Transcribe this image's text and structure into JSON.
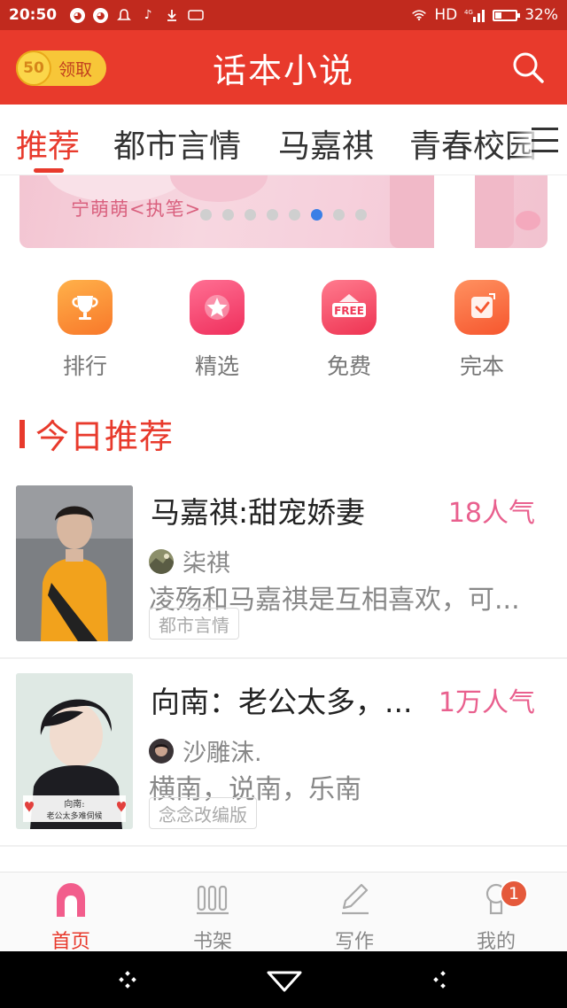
{
  "status_bar": {
    "time": "20:50",
    "network": "HD",
    "signal_label": "4G",
    "battery": "32%",
    "battery_level": 0.32
  },
  "header": {
    "coin_value": "50",
    "coin_label": "领取",
    "title": "话本小说"
  },
  "tabs": [
    {
      "label": "推荐",
      "active": true
    },
    {
      "label": "都市言情"
    },
    {
      "label": "马嘉祺"
    },
    {
      "label": "青春校园"
    }
  ],
  "banner": {
    "author_text": "宁萌萌<执笔>",
    "page_count": 8,
    "active_page": 6
  },
  "entries": [
    {
      "label": "排行",
      "icon": "trophy-icon",
      "color": "#fb8a2e"
    },
    {
      "label": "精选",
      "icon": "star-icon",
      "color": "#f6456e"
    },
    {
      "label": "免费",
      "icon": "free-icon",
      "color": "#f74a6a"
    },
    {
      "label": "完本",
      "icon": "check-icon",
      "color": "#fb6a3e"
    }
  ],
  "section": {
    "title": "今日推荐"
  },
  "books": [
    {
      "title": "马嘉祺:甜宠娇妻",
      "popularity": "18人气",
      "author": "柒祺",
      "description": "凌殇和马嘉祺是互相喜欢，可...",
      "tag": "都市言情"
    },
    {
      "title": "向南：老公太多，...",
      "popularity": "1万人气",
      "author": "沙雕沫.",
      "description": "横南，说南，乐南",
      "tag": "念念改编版",
      "cover_caption_1": "向南:",
      "cover_caption_2": "老公太多难伺候"
    }
  ],
  "bottom_nav": [
    {
      "label": "首页",
      "icon": "home-icon",
      "active": true
    },
    {
      "label": "书架",
      "icon": "bookshelf-icon"
    },
    {
      "label": "写作",
      "icon": "pencil-icon"
    },
    {
      "label": "我的",
      "icon": "profile-icon",
      "badge": "1"
    }
  ],
  "colors": {
    "brand": "#e83a2c",
    "status_bar": "#c12a1e",
    "popularity": "#e9608e"
  }
}
